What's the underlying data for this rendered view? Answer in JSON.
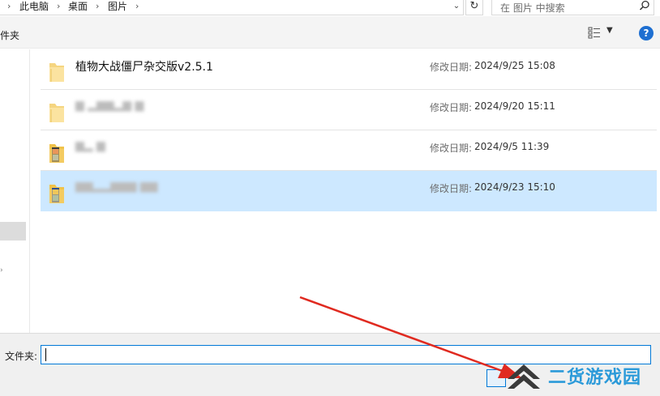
{
  "breadcrumb": {
    "items": [
      "此电脑",
      "桌面",
      "图片"
    ],
    "separator": "›"
  },
  "search": {
    "placeholder": "在 图片 中搜索"
  },
  "toolbar": {
    "new_folder_label": "件夹",
    "help_label": "?"
  },
  "files": [
    {
      "name": "植物大战僵尸杂交版v2.5.1",
      "date_label": "修改日期:",
      "date": "2024/9/25 15:08",
      "icon": "folder-icon",
      "blurred": false,
      "selected": false
    },
    {
      "name": "",
      "date_label": "修改日期:",
      "date": "2024/9/20 15:11",
      "icon": "folder-icon",
      "blurred": true,
      "selected": false
    },
    {
      "name": "",
      "date_label": "修改日期:",
      "date": "2024/9/5 11:39",
      "icon": "image-folder-icon",
      "blurred": true,
      "selected": false
    },
    {
      "name": "",
      "date_label": "修改日期:",
      "date": "2024/9/23 15:10",
      "icon": "image-folder-icon",
      "blurred": true,
      "selected": true
    }
  ],
  "bottom": {
    "folder_label": "文件夹:",
    "folder_value": ""
  },
  "watermark": {
    "text": "二货游戏园"
  },
  "colors": {
    "accent": "#0078d7",
    "selection": "#cde8ff",
    "annotation_arrow": "#e02a20",
    "watermark": "#2b9ad9"
  }
}
